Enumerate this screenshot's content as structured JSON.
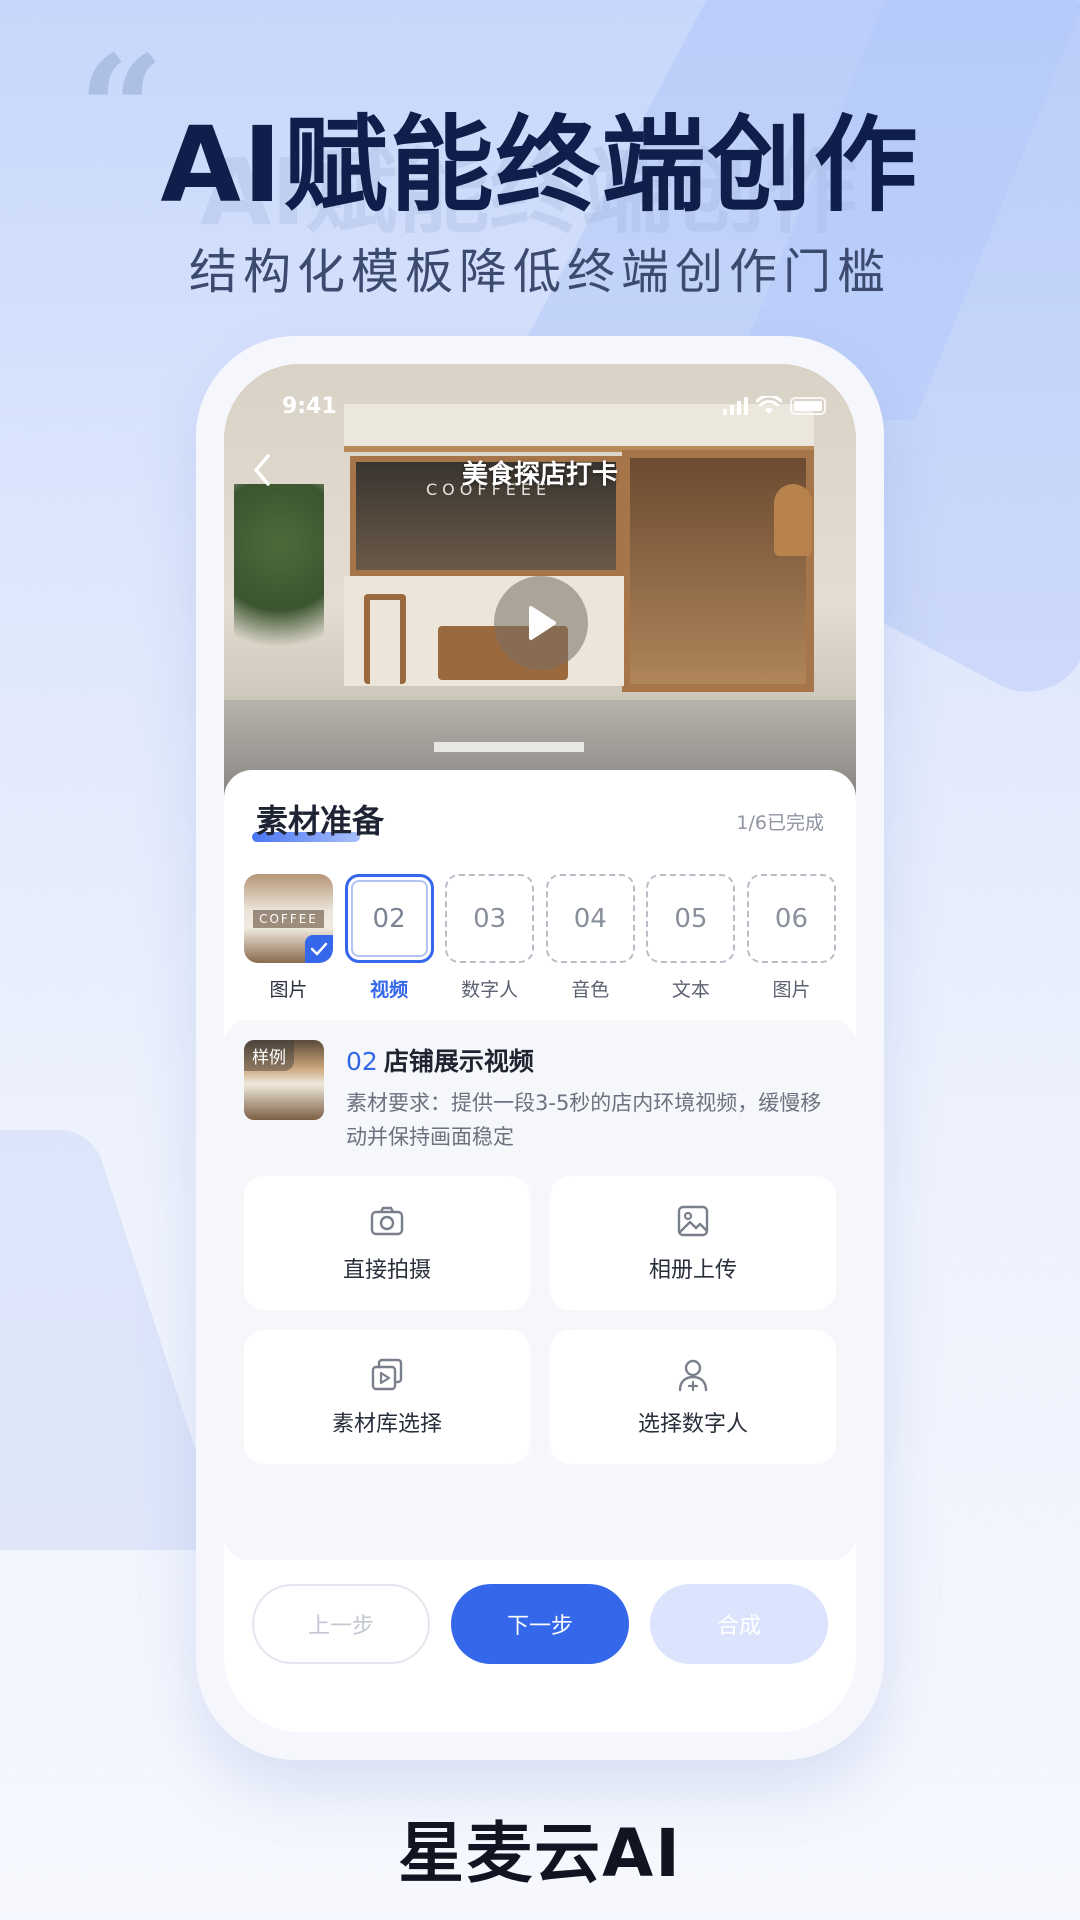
{
  "headline": "AI赋能终端创作",
  "headline_shadow": "AI赋能终端创作",
  "subline": "结构化模板降低终端创作门槛",
  "quote_mark": "“",
  "phone": {
    "status_time": "9:41",
    "hero_title": "美食探店打卡",
    "cafe_sign": "COOFFEEE",
    "panel_title": "素材准备",
    "progress": "1/6已完成",
    "steps": [
      {
        "box": "",
        "thumb_text": "COFFEE",
        "label": "图片",
        "state": "done"
      },
      {
        "box": "02",
        "label": "视频",
        "state": "active"
      },
      {
        "box": "03",
        "label": "数字人",
        "state": "pending"
      },
      {
        "box": "04",
        "label": "音色",
        "state": "pending"
      },
      {
        "box": "05",
        "label": "文本",
        "state": "pending"
      },
      {
        "box": "06",
        "label": "图片",
        "state": "pending"
      }
    ],
    "card": {
      "sample_tag": "样例",
      "number": "02",
      "title": "店铺展示视频",
      "desc": "素材要求：提供一段3-5秒的店内环境视频，缓慢移动并保持画面稳定"
    },
    "actions": [
      {
        "icon": "camera-icon",
        "label": "直接拍摄"
      },
      {
        "icon": "image-icon",
        "label": "相册上传"
      },
      {
        "icon": "library-icon",
        "label": "素材库选择"
      },
      {
        "icon": "person-icon",
        "label": "选择数字人"
      }
    ],
    "buttons": {
      "prev": "上一步",
      "next": "下一步",
      "compose": "合成"
    }
  },
  "brand": "星麦云AI",
  "colors": {
    "accent": "#3567ea",
    "title": "#0f1e4a",
    "disabled_button": "#dbe4fc"
  }
}
